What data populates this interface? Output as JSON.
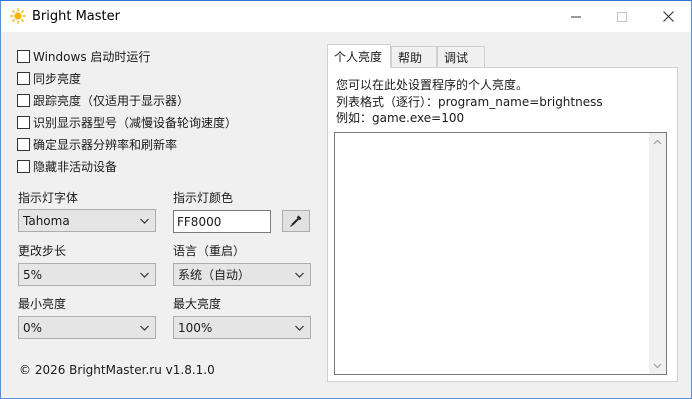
{
  "window": {
    "title": "Bright Master"
  },
  "options": [
    {
      "label": "Windows 启动时运行",
      "checked": false
    },
    {
      "label": "同步亮度",
      "checked": false
    },
    {
      "label": "跟踪亮度（仅适用于显示器）",
      "checked": false
    },
    {
      "label": "识别显示器型号（减慢设备轮询速度）",
      "checked": false
    },
    {
      "label": "确定显示器分辨率和刷新率",
      "checked": false
    },
    {
      "label": "隐藏非活动设备",
      "checked": false
    }
  ],
  "indicator_font": {
    "label": "指示灯字体",
    "value": "Tahoma"
  },
  "indicator_color": {
    "label": "指示灯颜色",
    "value": "FF8000"
  },
  "step": {
    "label": "更改步长",
    "value": "5%"
  },
  "language": {
    "label": "语言（重启）",
    "value": "系统（自动）"
  },
  "min_brightness": {
    "label": "最小亮度",
    "value": "0%"
  },
  "max_brightness": {
    "label": "最大亮度",
    "value": "100%"
  },
  "footer": "© 2026 BrightMaster.ru v1.8.1.0",
  "tabs": [
    {
      "label": "个人亮度",
      "active": true
    },
    {
      "label": "帮助",
      "active": false
    },
    {
      "label": "调试",
      "active": false
    }
  ],
  "personal": {
    "line1": "您可以在此处设置程序的个人亮度。",
    "line2": "列表格式（逐行）：program_name=brightness",
    "line3": "例如：game.exe=100",
    "list_value": ""
  },
  "icons": {
    "app": "sun-icon",
    "minimize": "minimize-icon",
    "maximize": "maximize-icon",
    "close": "close-icon",
    "picker": "eyedropper-icon"
  },
  "colors": {
    "accent": "#2f73d9",
    "sun": "#f5b400"
  }
}
